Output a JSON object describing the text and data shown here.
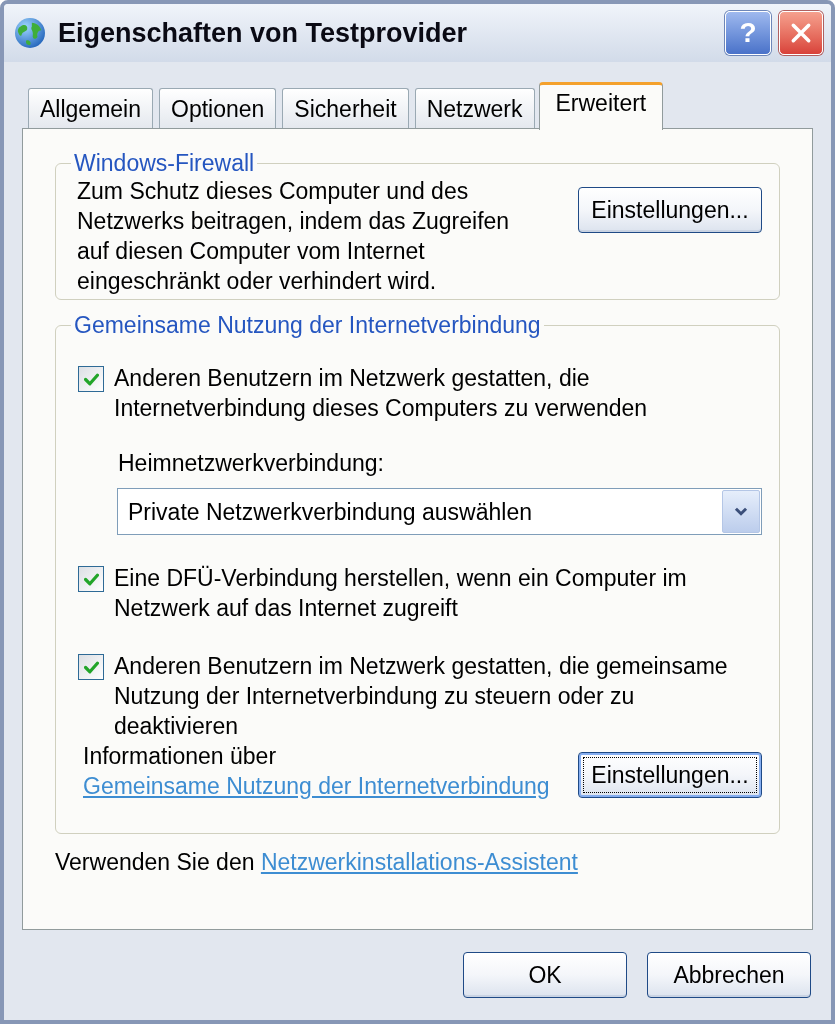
{
  "window": {
    "title": "Eigenschaften von Testprovider",
    "help_button": "?"
  },
  "tabs": [
    {
      "label": "Allgemein",
      "selected": false
    },
    {
      "label": "Optionen",
      "selected": false
    },
    {
      "label": "Sicherheit",
      "selected": false
    },
    {
      "label": "Netzwerk",
      "selected": false
    },
    {
      "label": "Erweitert",
      "selected": true
    }
  ],
  "firewall": {
    "title": "Windows-Firewall",
    "description": "Zum Schutz dieses Computer und des Netzwerks beitragen, indem das Zugreifen auf diesen Computer vom Internet eingeschränkt oder verhindert wird.",
    "button": {
      "label": "Einstellungen...",
      "focused": false
    }
  },
  "sharing": {
    "title": "Gemeinsame Nutzung der Internetverbindung",
    "items": [
      {
        "kind": "checkbox",
        "label": "Anderen Benutzern im Netzwerk gestatten, die Internetverbindung dieses Computers zu verwenden",
        "checked": true
      },
      {
        "kind": "dropdown",
        "label": "Heimnetzwerkverbindung:",
        "value": "Private Netzwerkverbindung auswählen"
      },
      {
        "kind": "checkbox",
        "label": "Eine DFÜ-Verbindung herstellen, wenn ein Computer im Netzwerk auf das Internet zugreift",
        "checked": true
      },
      {
        "kind": "checkbox",
        "label": "Anderen Benutzern im Netzwerk gestatten, die gemeinsame Nutzung der Internetverbindung zu steuern oder zu deaktivieren",
        "checked": true
      }
    ],
    "info": {
      "text": "Informationen über",
      "link": "Gemeinsame Nutzung der Internetverbindung"
    },
    "button": {
      "label": "Einstellungen...",
      "focused": true
    }
  },
  "footer": {
    "text": "Verwenden Sie den",
    "link": "Netzwerkinstallations-Assistent"
  },
  "buttons": [
    {
      "label": "OK"
    },
    {
      "label": "Abbrechen"
    }
  ]
}
